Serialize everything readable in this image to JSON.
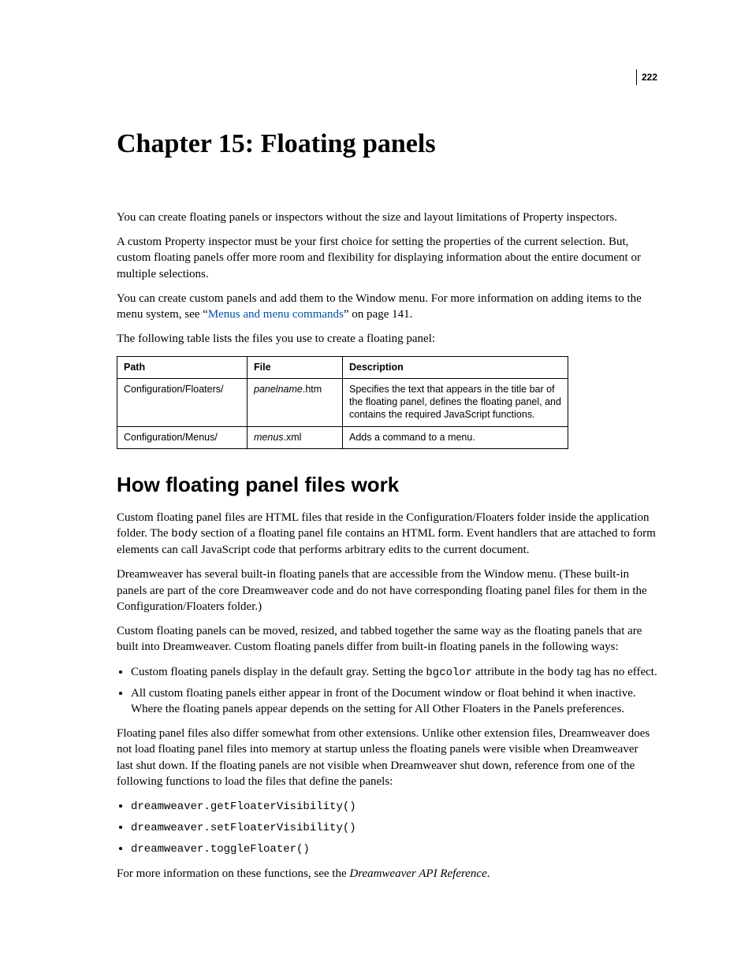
{
  "pageNumber": "222",
  "chapterTitle": "Chapter 15: Floating panels",
  "para1": "You can create floating panels or inspectors without the size and layout limitations of Property inspectors.",
  "para2": "A custom Property inspector must be your first choice for setting the properties of the current selection. But, custom floating panels offer more room and flexibility for displaying information about the entire document or multiple selections.",
  "para3a": "You can create custom panels and add them to the Window menu. For more information on adding items to the menu system, see “",
  "para3link": "Menus and menu commands",
  "para3b": "” on page 141.",
  "para4": "The following table lists the files you use to create a floating panel:",
  "table": {
    "headers": {
      "path": "Path",
      "file": "File",
      "desc": "Description"
    },
    "rows": [
      {
        "path": "Configuration/Floaters/",
        "fileItalic": "panelname",
        "fileRest": ".htm",
        "desc": "Specifies the text that appears in the title bar of the floating panel, defines the floating panel, and contains the required JavaScript functions."
      },
      {
        "path": "Configuration/Menus/",
        "fileItalic": "menus",
        "fileRest": ".xml",
        "desc": "Adds a command to a menu."
      }
    ]
  },
  "section2Title": "How floating panel files work",
  "s2p1a": "Custom floating panel files are HTML files that reside in the Configuration/Floaters folder inside the application folder. The ",
  "s2p1code1": "body",
  "s2p1b": " section of a floating panel file contains an HTML form. Event handlers that are attached to form elements can call JavaScript code that performs arbitrary edits to the current document.",
  "s2p2": "Dreamweaver has several built-in floating panels that are accessible from the Window menu. (These built-in panels are part of the core Dreamweaver code and do not have corresponding floating panel files for them in the Configuration/Floaters folder.)",
  "s2p3": "Custom floating panels can be moved, resized, and tabbed together the same way as the floating panels that are built into Dreamweaver. Custom floating panels differ from built-in floating panels in the following ways:",
  "bulletsA": [
    {
      "a": "Custom floating panels display in the default gray. Setting the ",
      "code1": "bgcolor",
      "b": " attribute in the ",
      "code2": "body",
      "c": " tag has no effect."
    },
    {
      "a": "All custom floating panels either appear in front of the Document window or float behind it when inactive. Where the floating panels appear depends on the setting for All Other Floaters in the Panels preferences.",
      "code1": "",
      "b": "",
      "code2": "",
      "c": ""
    }
  ],
  "s2p4": "Floating panel files also differ somewhat from other extensions. Unlike other extension files, Dreamweaver does not load floating panel files into memory at startup unless the floating panels were visible when Dreamweaver last shut down. If the floating panels are not visible when Dreamweaver shut down, reference from one of the following functions to load the files that define the panels:",
  "bulletsB": [
    "dreamweaver.getFloaterVisibility()",
    "dreamweaver.setFloaterVisibility()",
    "dreamweaver.toggleFloater()"
  ],
  "s2p5a": "For more information on these functions, see the ",
  "s2p5italic": "Dreamweaver API Reference",
  "s2p5b": "."
}
